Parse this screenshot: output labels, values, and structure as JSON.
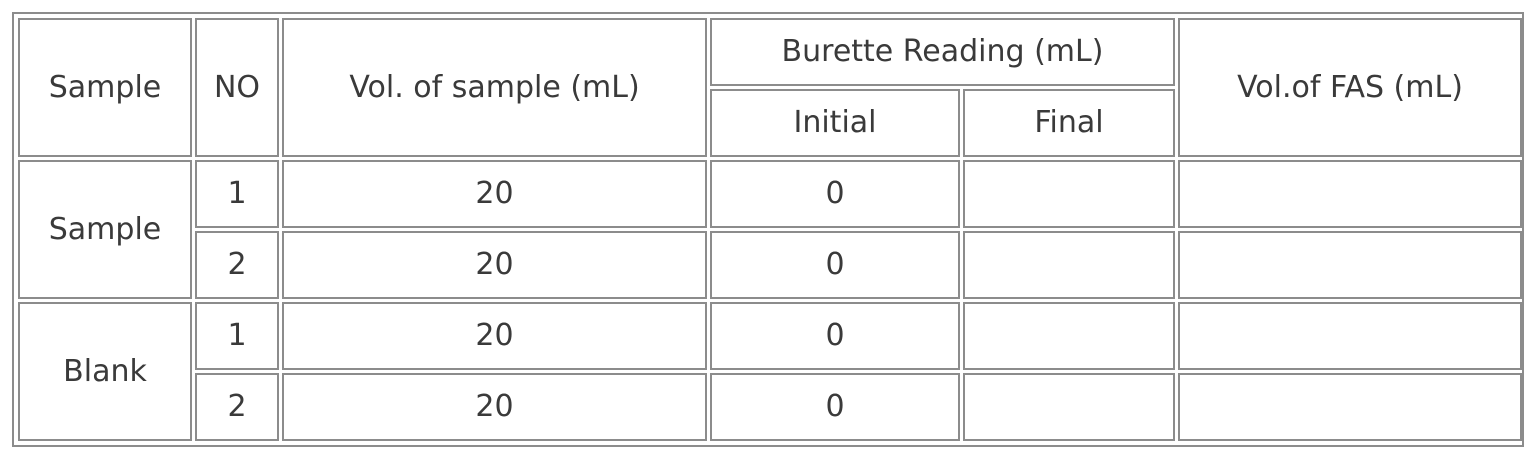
{
  "table": {
    "headers": {
      "sample": "Sample",
      "no": "NO",
      "vol_sample": "Vol. of sample (mL)",
      "burette": "Burette Reading (mL)",
      "initial": "Initial",
      "final": "Final",
      "vol_fas": "Vol.of FAS (mL)"
    },
    "groups": [
      {
        "label": "Sample",
        "rows": [
          {
            "no": "1",
            "vol": "20",
            "initial": "0",
            "final": "",
            "fas": ""
          },
          {
            "no": "2",
            "vol": "20",
            "initial": "0",
            "final": "",
            "fas": ""
          }
        ]
      },
      {
        "label": "Blank",
        "rows": [
          {
            "no": "1",
            "vol": "20",
            "initial": "0",
            "final": "",
            "fas": ""
          },
          {
            "no": "2",
            "vol": "20",
            "initial": "0",
            "final": "",
            "fas": ""
          }
        ]
      }
    ]
  }
}
